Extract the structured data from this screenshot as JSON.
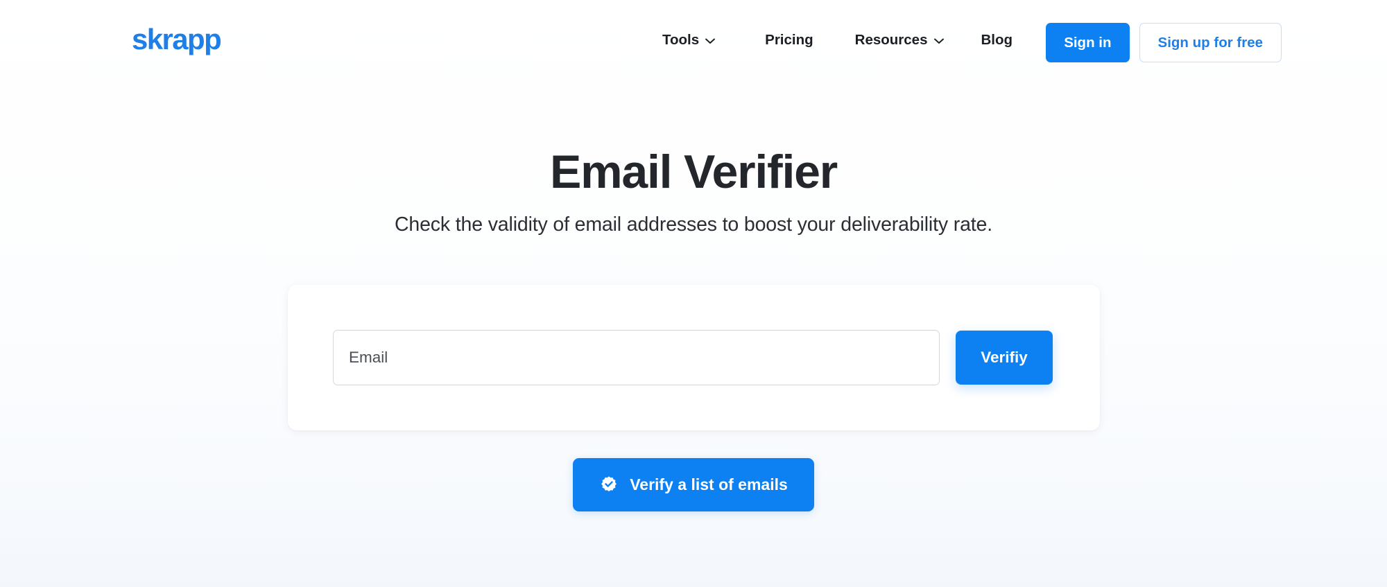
{
  "brand": {
    "name": "skrapp",
    "color": "#1E7FE8"
  },
  "header": {
    "nav": [
      {
        "label": "Tools",
        "icon": "chevron-down-icon",
        "has_dropdown": true
      },
      {
        "label": "Pricing",
        "icon": null,
        "has_dropdown": false
      },
      {
        "label": "Resources",
        "icon": "chevron-down-icon",
        "has_dropdown": true
      },
      {
        "label": "Blog",
        "icon": null,
        "has_dropdown": false
      }
    ],
    "sign_in_label": "Sign in",
    "sign_up_label": "Sign up for free"
  },
  "hero": {
    "title": "Email Verifier",
    "subtitle": "Check the validity of email addresses to boost your deliverability rate."
  },
  "verifier_card": {
    "email_placeholder": "Email",
    "email_value": "",
    "verify_button_label": "Verifiy"
  },
  "bulk_cta": {
    "label": "Verify a list of emails",
    "icon": "verified-badge-icon"
  },
  "colors": {
    "primary_blue": "#0D80F2",
    "brand_blue": "#1E7FE8",
    "outline_border": "#C3DDFA",
    "input_border": "#D4D6D8",
    "page_background": "#FBFCFE",
    "text_dark": "#23262B"
  }
}
